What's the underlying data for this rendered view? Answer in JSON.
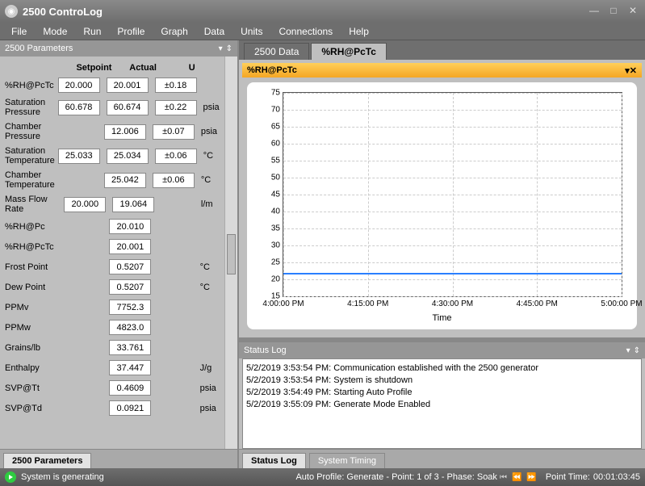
{
  "window": {
    "title": "2500 ControLog"
  },
  "menubar": [
    "File",
    "Mode",
    "Run",
    "Profile",
    "Graph",
    "Data",
    "Units",
    "Connections",
    "Help"
  ],
  "left_panel": {
    "title": "2500 Parameters",
    "cols": {
      "label": "",
      "setpoint": "Setpoint",
      "actual": "Actual",
      "u": "U"
    },
    "rows": [
      {
        "label": "%RH@PcTc",
        "setpoint": "20.000",
        "actual": "20.001",
        "u": "±0.18",
        "unit": ""
      },
      {
        "label": "Saturation Pressure",
        "setpoint": "60.678",
        "actual": "60.674",
        "u": "±0.22",
        "unit": "psia"
      },
      {
        "label": "Chamber Pressure",
        "setpoint": "",
        "actual": "12.006",
        "u": "±0.07",
        "unit": "psia"
      },
      {
        "label": "Saturation Temperature",
        "setpoint": "25.033",
        "actual": "25.034",
        "u": "±0.06",
        "unit": "°C"
      },
      {
        "label": "Chamber Temperature",
        "setpoint": "",
        "actual": "25.042",
        "u": "±0.06",
        "unit": "°C"
      },
      {
        "label": "Mass Flow Rate",
        "setpoint": "20.000",
        "actual": "19.064",
        "u": "",
        "unit": "l/m"
      },
      {
        "label": "%RH@Pc",
        "setpoint": "",
        "actual": "20.010",
        "u": "",
        "unit": ""
      },
      {
        "label": "%RH@PcTc",
        "setpoint": "",
        "actual": "20.001",
        "u": "",
        "unit": ""
      },
      {
        "label": "Frost Point",
        "setpoint": "",
        "actual": "0.5207",
        "u": "",
        "unit": "°C"
      },
      {
        "label": "Dew Point",
        "setpoint": "",
        "actual": "0.5207",
        "u": "",
        "unit": "°C"
      },
      {
        "label": "PPMv",
        "setpoint": "",
        "actual": "7752.3",
        "u": "",
        "unit": ""
      },
      {
        "label": "PPMw",
        "setpoint": "",
        "actual": "4823.0",
        "u": "",
        "unit": ""
      },
      {
        "label": "Grains/lb",
        "setpoint": "",
        "actual": "33.761",
        "u": "",
        "unit": ""
      },
      {
        "label": "Enthalpy",
        "setpoint": "",
        "actual": "37.447",
        "u": "",
        "unit": "J/g"
      },
      {
        "label": "SVP@Tt",
        "setpoint": "",
        "actual": "0.4609",
        "u": "",
        "unit": "psia"
      },
      {
        "label": "SVP@Td",
        "setpoint": "",
        "actual": "0.0921",
        "u": "",
        "unit": "psia"
      }
    ],
    "tab": "2500 Parameters"
  },
  "right_tabs": {
    "data": "2500 Data",
    "chart": "%RH@PcTc",
    "active": "chart"
  },
  "chart_header": "%RH@PcTc",
  "chart_data": {
    "type": "line",
    "xlabel": "Time",
    "ylabel": "",
    "ylim": [
      15,
      75
    ],
    "yticks": [
      15,
      20,
      25,
      30,
      35,
      40,
      45,
      50,
      55,
      60,
      65,
      70,
      75
    ],
    "xticks": [
      "4:00:00 PM",
      "4:15:00 PM",
      "4:30:00 PM",
      "4:45:00 PM",
      "5:00:00 PM"
    ],
    "series": [
      {
        "name": "%RH@PcTc",
        "value": 22
      }
    ]
  },
  "status_log": {
    "title": "Status Log",
    "entries": [
      {
        "ts": "5/2/2019 3:53:54 PM:",
        "msg": "Communication established with the 2500 generator"
      },
      {
        "ts": "5/2/2019 3:53:54 PM:",
        "msg": "System is shutdown"
      },
      {
        "ts": "5/2/2019 3:54:49 PM:",
        "msg": "Starting Auto Profile"
      },
      {
        "ts": "5/2/2019 3:55:09 PM:",
        "msg": "Generate Mode Enabled"
      }
    ],
    "tabs": [
      "Status Log",
      "System Timing"
    ]
  },
  "statusbar": {
    "left": "System is generating",
    "profile": "Auto Profile: Generate - Point: 1 of 3 - Phase: Soak",
    "point_time_label": "Point Time:",
    "point_time": "00:01:03:45"
  }
}
